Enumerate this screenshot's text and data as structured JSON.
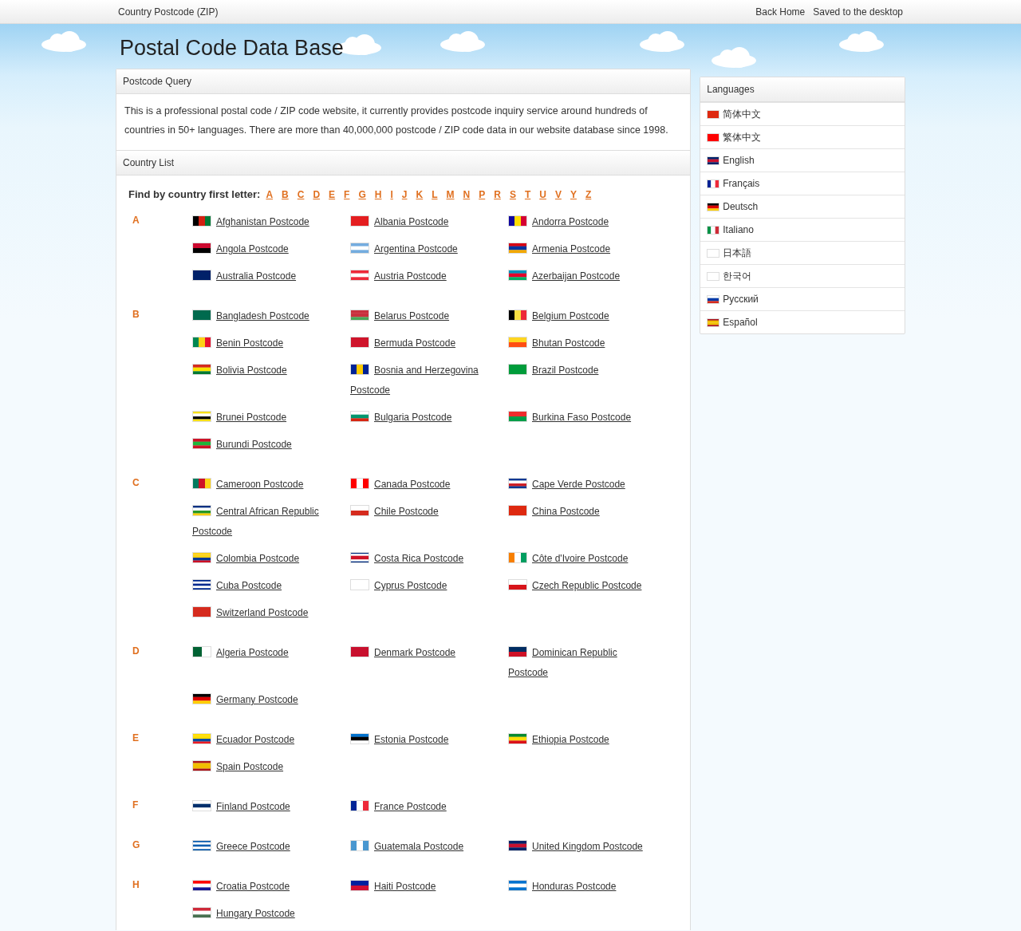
{
  "topbar": {
    "title": "Country Postcode (ZIP)",
    "links": [
      "Back Home",
      "Saved to the desktop"
    ]
  },
  "header": {
    "title": "Postal Code Data Base"
  },
  "query_panel": {
    "title": "Postcode Query",
    "text": "This is a professional postal code / ZIP code website, it currently provides postcode inquiry service around hundreds of countries in 50+ languages. There are more than 40,000,000 postcode / ZIP code data in our website database since 1998."
  },
  "country_panel": {
    "title": "Country List",
    "finder_label": "Find by country first letter:",
    "letters": [
      "A",
      "B",
      "C",
      "D",
      "E",
      "F",
      "G",
      "H",
      "I",
      "J",
      "K",
      "L",
      "M",
      "N",
      "P",
      "R",
      "S",
      "T",
      "U",
      "V",
      "Y",
      "Z"
    ],
    "groups": [
      {
        "letter": "A",
        "countries": [
          "Afghanistan Postcode",
          "Albania Postcode",
          "Andorra Postcode",
          "Angola Postcode",
          "Argentina Postcode",
          "Armenia Postcode",
          "Australia Postcode",
          "Austria Postcode",
          "Azerbaijan Postcode"
        ]
      },
      {
        "letter": "B",
        "countries": [
          "Bangladesh Postcode",
          "Belarus Postcode",
          "Belgium Postcode",
          "Benin Postcode",
          "Bermuda Postcode",
          "Bhutan Postcode",
          "Bolivia Postcode",
          "Bosnia and Herzegovina Postcode",
          "Brazil Postcode",
          "Brunei Postcode",
          "Bulgaria Postcode",
          "Burkina Faso Postcode",
          "Burundi Postcode"
        ]
      },
      {
        "letter": "C",
        "countries": [
          "Cameroon Postcode",
          "Canada Postcode",
          "Cape Verde Postcode",
          "Central African Republic Postcode",
          "Chile Postcode",
          "China Postcode",
          "Colombia Postcode",
          "Costa Rica Postcode",
          "Côte d'Ivoire Postcode",
          "Cuba Postcode",
          "Cyprus Postcode",
          "Czech Republic Postcode",
          "Switzerland Postcode"
        ]
      },
      {
        "letter": "D",
        "countries": [
          "Algeria Postcode",
          "Denmark Postcode",
          "Dominican Republic Postcode",
          "Germany Postcode"
        ]
      },
      {
        "letter": "E",
        "countries": [
          "Ecuador Postcode",
          "Estonia Postcode",
          "Ethiopia Postcode",
          "Spain Postcode"
        ]
      },
      {
        "letter": "F",
        "countries": [
          "Finland Postcode",
          "France Postcode"
        ]
      },
      {
        "letter": "G",
        "countries": [
          "Greece Postcode",
          "Guatemala Postcode",
          "United Kingdom Postcode"
        ]
      },
      {
        "letter": "H",
        "countries": [
          "Croatia Postcode",
          "Haiti Postcode",
          "Honduras Postcode",
          "Hungary Postcode"
        ]
      }
    ]
  },
  "languages": {
    "title": "Languages",
    "items": [
      "简体中文",
      "繁体中文",
      "English",
      "Français",
      "Deutsch",
      "Italiano",
      "日本語",
      "한국어",
      "Русский",
      "Español"
    ]
  }
}
